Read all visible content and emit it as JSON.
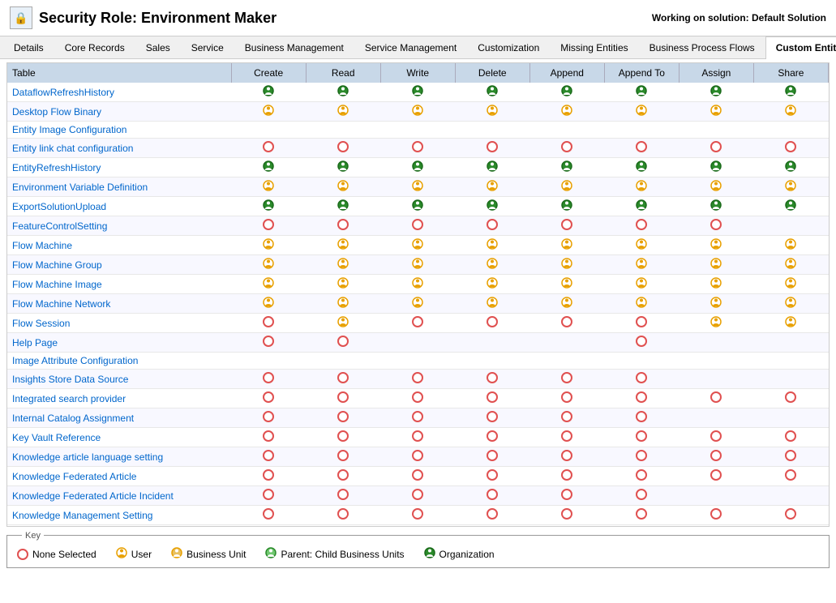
{
  "header": {
    "title": "Security Role: Environment Maker",
    "working_on": "Working on solution: Default Solution",
    "icon": "🔒"
  },
  "tabs": [
    {
      "label": "Details",
      "active": false
    },
    {
      "label": "Core Records",
      "active": false
    },
    {
      "label": "Sales",
      "active": false
    },
    {
      "label": "Service",
      "active": false
    },
    {
      "label": "Business Management",
      "active": false
    },
    {
      "label": "Service Management",
      "active": false
    },
    {
      "label": "Customization",
      "active": false
    },
    {
      "label": "Missing Entities",
      "active": false
    },
    {
      "label": "Business Process Flows",
      "active": false
    },
    {
      "label": "Custom Entities",
      "active": true
    }
  ],
  "table": {
    "columns": [
      "Table",
      "Create",
      "Read",
      "Write",
      "Delete",
      "Append",
      "Append To",
      "Assign",
      "Share"
    ],
    "rows": [
      {
        "name": "DataflowRefreshHistory",
        "create": "org",
        "read": "org",
        "write": "org",
        "delete": "org",
        "append": "org",
        "appendTo": "org",
        "assign": "org",
        "share": "org"
      },
      {
        "name": "Desktop Flow Binary",
        "create": "user",
        "read": "user",
        "write": "user",
        "delete": "user",
        "append": "user",
        "appendTo": "user",
        "assign": "user",
        "share": "user"
      },
      {
        "name": "Entity Image Configuration",
        "create": "",
        "read": "",
        "write": "",
        "delete": "",
        "append": "",
        "appendTo": "",
        "assign": "",
        "share": ""
      },
      {
        "name": "Entity link chat configuration",
        "create": "none",
        "read": "none",
        "write": "none",
        "delete": "none",
        "append": "none",
        "appendTo": "none",
        "assign": "none",
        "share": "none"
      },
      {
        "name": "EntityRefreshHistory",
        "create": "org",
        "read": "org",
        "write": "org",
        "delete": "org",
        "append": "org",
        "appendTo": "org",
        "assign": "org",
        "share": "org"
      },
      {
        "name": "Environment Variable Definition",
        "create": "user",
        "read": "user",
        "write": "user",
        "delete": "user",
        "append": "user",
        "appendTo": "user",
        "assign": "user",
        "share": "user"
      },
      {
        "name": "ExportSolutionUpload",
        "create": "org",
        "read": "org",
        "write": "org",
        "delete": "org",
        "append": "org",
        "appendTo": "org",
        "assign": "org",
        "share": "org"
      },
      {
        "name": "FeatureControlSetting",
        "create": "none",
        "read": "none",
        "write": "none",
        "delete": "none",
        "append": "none",
        "appendTo": "none",
        "assign": "none",
        "share": ""
      },
      {
        "name": "Flow Machine",
        "create": "user",
        "read": "user",
        "write": "user",
        "delete": "user",
        "append": "user",
        "appendTo": "user",
        "assign": "user",
        "share": "user"
      },
      {
        "name": "Flow Machine Group",
        "create": "user",
        "read": "user",
        "write": "user",
        "delete": "user",
        "append": "user",
        "appendTo": "user",
        "assign": "user",
        "share": "user"
      },
      {
        "name": "Flow Machine Image",
        "create": "user",
        "read": "user",
        "write": "user",
        "delete": "user",
        "append": "user",
        "appendTo": "user",
        "assign": "user",
        "share": "user"
      },
      {
        "name": "Flow Machine Network",
        "create": "user",
        "read": "user",
        "write": "user",
        "delete": "user",
        "append": "user",
        "appendTo": "user",
        "assign": "user",
        "share": "user"
      },
      {
        "name": "Flow Session",
        "create": "none",
        "read": "user",
        "write": "none",
        "delete": "none",
        "append": "none",
        "appendTo": "none",
        "assign": "user",
        "share": "user"
      },
      {
        "name": "Help Page",
        "create": "none",
        "read": "none",
        "write": "",
        "delete": "",
        "append": "",
        "appendTo": "none",
        "assign": "",
        "share": ""
      },
      {
        "name": "Image Attribute Configuration",
        "create": "",
        "read": "",
        "write": "",
        "delete": "",
        "append": "",
        "appendTo": "",
        "assign": "",
        "share": ""
      },
      {
        "name": "Insights Store Data Source",
        "create": "none",
        "read": "none",
        "write": "none",
        "delete": "none",
        "append": "none",
        "appendTo": "none",
        "assign": "",
        "share": ""
      },
      {
        "name": "Integrated search provider",
        "create": "none",
        "read": "none",
        "write": "none",
        "delete": "none",
        "append": "none",
        "appendTo": "none",
        "assign": "none",
        "share": "none"
      },
      {
        "name": "Internal Catalog Assignment",
        "create": "none",
        "read": "none",
        "write": "none",
        "delete": "none",
        "append": "none",
        "appendTo": "none",
        "assign": "",
        "share": ""
      },
      {
        "name": "Key Vault Reference",
        "create": "none",
        "read": "none",
        "write": "none",
        "delete": "none",
        "append": "none",
        "appendTo": "none",
        "assign": "none",
        "share": "none"
      },
      {
        "name": "Knowledge article language setting",
        "create": "none",
        "read": "none",
        "write": "none",
        "delete": "none",
        "append": "none",
        "appendTo": "none",
        "assign": "none",
        "share": "none"
      },
      {
        "name": "Knowledge Federated Article",
        "create": "none",
        "read": "none",
        "write": "none",
        "delete": "none",
        "append": "none",
        "appendTo": "none",
        "assign": "none",
        "share": "none"
      },
      {
        "name": "Knowledge Federated Article Incident",
        "create": "none",
        "read": "none",
        "write": "none",
        "delete": "none",
        "append": "none",
        "appendTo": "none",
        "assign": "",
        "share": ""
      },
      {
        "name": "Knowledge Management Setting",
        "create": "none",
        "read": "none",
        "write": "none",
        "delete": "none",
        "append": "none",
        "appendTo": "none",
        "assign": "none",
        "share": "none"
      }
    ]
  },
  "key": {
    "title": "Key",
    "items": [
      {
        "label": "None Selected",
        "type": "none"
      },
      {
        "label": "User",
        "type": "user"
      },
      {
        "label": "Business Unit",
        "type": "bu"
      },
      {
        "label": "Parent: Child Business Units",
        "type": "parent"
      },
      {
        "label": "Organization",
        "type": "org"
      }
    ]
  }
}
